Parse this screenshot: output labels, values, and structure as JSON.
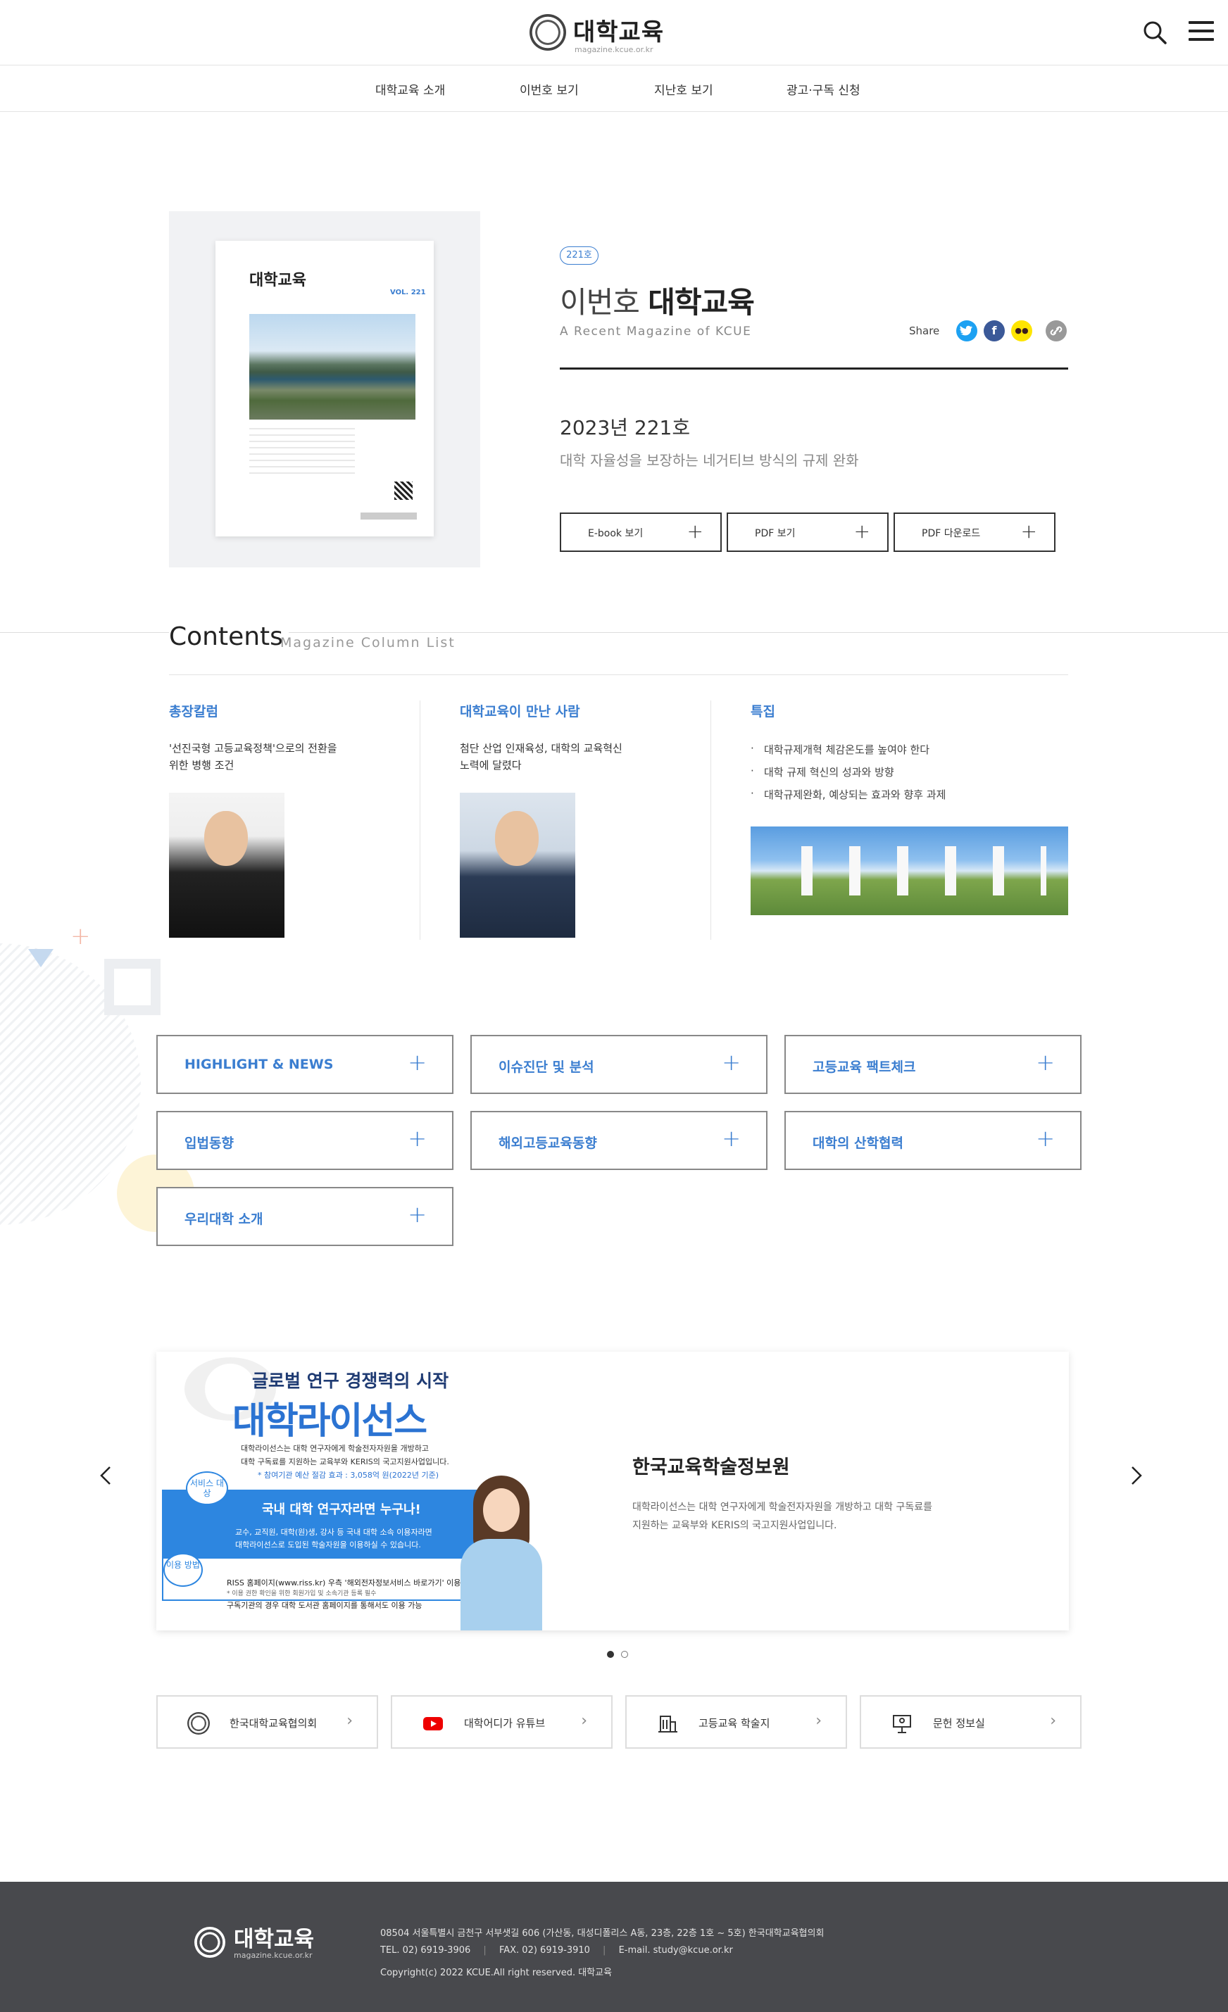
{
  "header": {
    "logo_title": "대학교육",
    "logo_url_text": "magazine.kcue.or.kr",
    "search_icon": "search-icon",
    "menu_icon": "hamburger-menu-icon"
  },
  "nav": {
    "items": [
      "대학교육 소개",
      "이번호 보기",
      "지난호 보기",
      "광고·구독 신청"
    ]
  },
  "issue": {
    "cover": {
      "title": "대학교육",
      "vol": "VOL. 221"
    },
    "badge": "221호",
    "title_light": "이번호",
    "title_bold": "대학교육",
    "subtitle": "A Recent Magazine of KCUE",
    "share_label": "Share",
    "share_icons": [
      "twitter-icon",
      "facebook-icon",
      "kakaotalk-icon",
      "link-icon"
    ],
    "share_colors": [
      "#1da1f2",
      "#3b5998",
      "#fee500",
      "#999999"
    ],
    "year_issue": "2023년 221호",
    "description": "대학 자율성을 보장하는 네거티브 방식의 규제 완화",
    "buttons": [
      "E-book 보기",
      "PDF 보기",
      "PDF 다운로드"
    ]
  },
  "contents": {
    "title": "Contents",
    "subtitle": "Magazine Column List",
    "columns": [
      {
        "category": "총장칼럼",
        "text1": "'선진국형 고등교육정책'으로의 전환을",
        "text2": "위한 병행 조건"
      },
      {
        "category": "대학교육이 만난 사람",
        "text1": "첨단 산업 인재육성, 대학의 교육혁신",
        "text2": "노력에 달렸다"
      },
      {
        "category": "특집",
        "bullets": [
          "대학규제개혁 체감온도를 높여야 한다",
          "대학 규제 혁신의 성과와 방향",
          "대학규제완화, 예상되는 효과와 향후 과제"
        ]
      }
    ]
  },
  "categories": [
    "HIGHLIGHT & NEWS",
    "이슈진단 및 분석",
    "고등교육 팩트체크",
    "입법동향",
    "해외고등교육동향",
    "대학의 산학협력",
    "우리대학 소개"
  ],
  "banner": {
    "headline": "글로벌 연구 경쟁력의 시작",
    "brand": "대학라이선스",
    "intro1": "대학라이선스는 대학 연구자에게 학술전자자원을 개방하고",
    "intro2": "대학 구독료를 지원하는 교육부와 KERIS의 국고지원사업입니다.",
    "intro3": "* 참여기관 예산 절감 효과 : 3,058억 원(2022년 기준)",
    "badge1": "서비스 대상",
    "bar_title": "국내 대학 연구자라면 누구나!",
    "bar_desc1": "교수, 교직원, 대학(원)생, 강사 등 국내 대학 소속 이용자라면",
    "bar_desc2": "대학라이선스로 도입된 학술자원을 이용하실 수 있습니다.",
    "badge2": "이용 방법",
    "method1": "RISS 홈페이지(www.riss.kr) 우측 '해외전자정보서비스 바로가기' 이용",
    "method_note": "* 이용 권한 확인을 위한 회원가입 및 소속기관 등록 필수",
    "method2": "구독기관의 경우 대학 도서관 홈페이지를 통해서도 이용 가능",
    "org_title": "한국교육학술정보원",
    "org_desc1": "대학라이선스는 대학 연구자에게 학술전자자원을 개방하고 대학 구독료를",
    "org_desc2": "지원하는 교육부와 KERIS의 국고지원사업입니다.",
    "prev_icon": "chevron-left-icon",
    "next_icon": "chevron-right-icon",
    "dots_active": 0,
    "dots_count": 2
  },
  "quick_links": [
    {
      "label": "한국대학교육협의회",
      "icon": "kcue-emblem-icon"
    },
    {
      "label": "대학어디가 유튜브",
      "icon": "youtube-icon"
    },
    {
      "label": "고등교육 학술지",
      "icon": "building-icon"
    },
    {
      "label": "문헌 정보실",
      "icon": "presentation-icon"
    }
  ],
  "footer": {
    "logo_title": "대학교육",
    "logo_url_text": "magazine.kcue.or.kr",
    "address": "08504 서울특별시 금천구 서부샛길 606 (가산동, 대성디폴리스 A동, 23층, 22층 1호 ~ 5호) 한국대학교육협의회",
    "tel": "TEL. 02) 6919-3906",
    "fax": "FAX. 02) 6919-3910",
    "email": "E-mail. study@kcue.or.kr",
    "copyright": "Copyright(c) 2022 KCUE.All right reserved. 대학교육"
  },
  "colors": {
    "accent": "#3b7ed0",
    "footer_bg": "#48494d"
  }
}
